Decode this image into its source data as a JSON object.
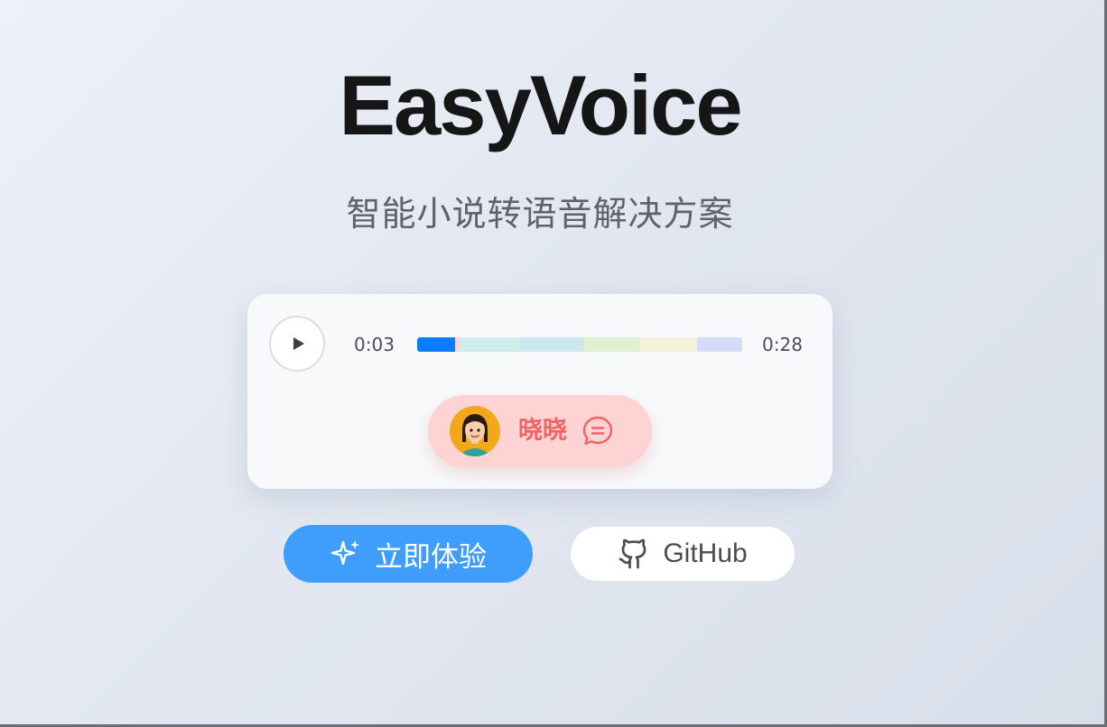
{
  "hero": {
    "title": "EasyVoice",
    "subtitle": "智能小说转语音解决方案"
  },
  "player": {
    "play_icon": "play-icon",
    "current_time": "0:03",
    "total_time": "0:28",
    "progress_fraction": 0.117,
    "segments": [
      {
        "fraction": 0.117,
        "color": "#0a7cff",
        "played": true
      },
      {
        "fraction": 0.017,
        "color": "#f7d5d8"
      },
      {
        "fraction": 0.183,
        "color": "#cdeeed"
      },
      {
        "fraction": 0.195,
        "color": "#cde7f0"
      },
      {
        "fraction": 0.175,
        "color": "#def0cf"
      },
      {
        "fraction": 0.175,
        "color": "#f6f1dc"
      },
      {
        "fraction": 0.138,
        "color": "#d4dcf8"
      }
    ]
  },
  "voice": {
    "avatar_icon": "girl-avatar-icon",
    "name": "晓晓",
    "chat_icon": "chat-bubble-icon"
  },
  "actions": {
    "try_label": "立即体验",
    "try_icon": "sparkle-icon",
    "github_label": "GitHub",
    "github_icon": "github-icon"
  },
  "colors": {
    "accent": "#3f9dfb",
    "progress_played": "#0a7cff",
    "voice_pill_bg": "#fed3d3",
    "voice_name": "#ef6464",
    "title": "#161616",
    "subtitle": "#5f6368"
  }
}
